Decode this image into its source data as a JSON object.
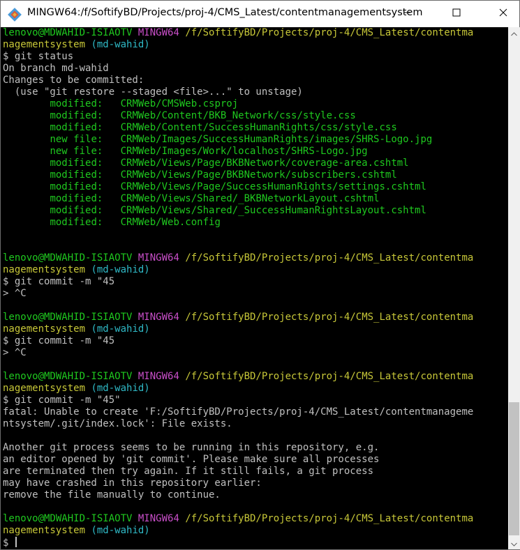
{
  "window": {
    "title": "MINGW64:/f/SoftifyBD/Projects/proj-4/CMS_Latest/contentmanagementsystem",
    "icon": "git-bash-icon",
    "controls": [
      "minimize-icon",
      "maximize-icon",
      "close-icon"
    ]
  },
  "prompt": {
    "user": "lenovo@MDWAHID-ISIAOTV",
    "env": "MINGW64",
    "path_line1": "/f/SoftifyBD/Projects/proj-4/CMS_Latest/contentma",
    "path_line2": "nagementsystem",
    "branch": "(md-wahid)",
    "symbol": "$"
  },
  "session": {
    "cmd1": "git status",
    "status_branch": "On branch md-wahid",
    "status_changes": "Changes to be committed:",
    "status_hint": "  (use \"git restore --staged <file>...\" to unstage)",
    "changes": [
      {
        "type": "modified:",
        "file": "CRMWeb/CMSWeb.csproj"
      },
      {
        "type": "modified:",
        "file": "CRMWeb/Content/BKB_Network/css/style.css"
      },
      {
        "type": "modified:",
        "file": "CRMWeb/Content/SuccessHumanRights/css/style.css"
      },
      {
        "type": "new file:",
        "file": "CRMWeb/Images/SuccessHumanRights/images/SHRS-Logo.jpg"
      },
      {
        "type": "new file:",
        "file": "CRMWeb/Images/Work/localhost/SHRS-Logo.jpg"
      },
      {
        "type": "modified:",
        "file": "CRMWeb/Views/Page/BKBNetwork/coverage-area.cshtml"
      },
      {
        "type": "modified:",
        "file": "CRMWeb/Views/Page/BKBNetwork/subscribers.cshtml"
      },
      {
        "type": "modified:",
        "file": "CRMWeb/Views/Page/SuccessHumanRights/settings.cshtml"
      },
      {
        "type": "modified:",
        "file": "CRMWeb/Views/Shared/_BKBNetworkLayout.cshtml"
      },
      {
        "type": "modified:",
        "file": "CRMWeb/Views/Shared/_SuccessHumanRightsLayout.cshtml"
      },
      {
        "type": "modified:",
        "file": "CRMWeb/Web.config"
      }
    ],
    "cmd2": "git commit -m \"45",
    "cont2": "> ^C",
    "cmd3": "git commit -m \"45",
    "cont3": "> ^C",
    "cmd4": "git commit -m \"45\"",
    "error": [
      "fatal: Unable to create 'F:/SoftifyBD/Projects/proj-4/CMS_Latest/contentmanageme",
      "ntsystem/.git/index.lock': File exists.",
      "",
      "Another git process seems to be running in this repository, e.g.",
      "an editor opened by 'git commit'. Please make sure all processes",
      "are terminated then try again. If it still fails, a git process",
      "may have crashed in this repository earlier:",
      "remove the file manually to continue."
    ]
  },
  "colors": {
    "background": "#000000",
    "user_host": "#1fc91f",
    "env": "#c94fc9",
    "path": "#c7c738",
    "branch": "#2fb9c6",
    "text": "#c0c0c0"
  }
}
